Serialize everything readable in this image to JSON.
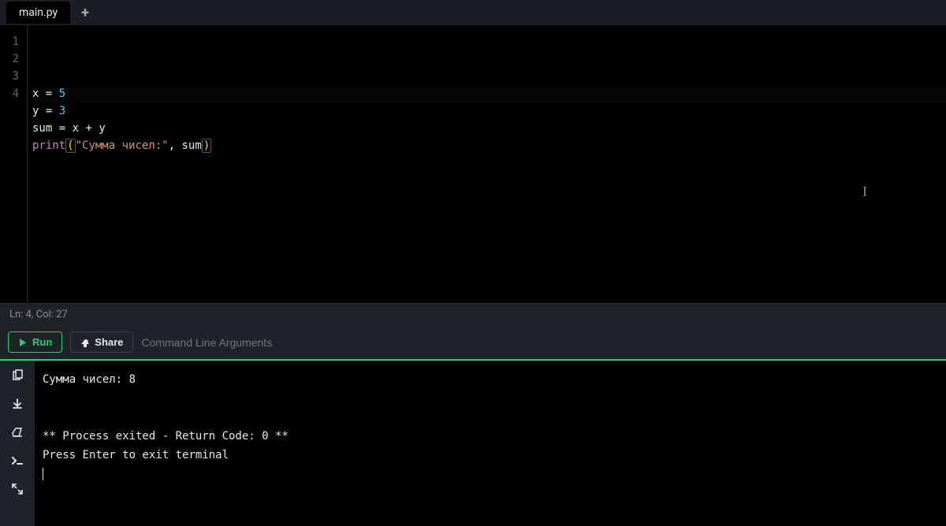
{
  "tabs": {
    "active": "main.py"
  },
  "code": {
    "lines": [
      {
        "num": "1",
        "html": "<span class='tok-var'>x</span> <span class='tok-op'>=</span> <span class='tok-num'>5</span>"
      },
      {
        "num": "2",
        "html": "<span class='tok-var'>y</span> <span class='tok-op'>=</span> <span class='tok-num'>3</span>"
      },
      {
        "num": "3",
        "html": "<span class='tok-var'>sum</span> <span class='tok-op'>=</span> <span class='tok-var'>x</span> <span class='tok-op'>+</span> <span class='tok-var'>y</span>"
      },
      {
        "num": "4",
        "html": "<span class='tok-func'>print</span><span class='tok-paren bracket-hl'>(</span><span class='tok-str'>\"Сумма чисел:\"</span><span class='tok-op'>,</span> <span class='tok-var'>sum</span><span class='tok-paren bracket-hl'>)</span>"
      }
    ]
  },
  "status": {
    "text": "Ln: 4,  Col: 27"
  },
  "toolbar": {
    "run_label": "Run",
    "share_label": "Share",
    "cmd_placeholder": "Command Line Arguments"
  },
  "terminal": {
    "lines": [
      "Сумма чисел: 8",
      "",
      "",
      "** Process exited - Return Code: 0 **",
      "Press Enter to exit terminal"
    ]
  }
}
